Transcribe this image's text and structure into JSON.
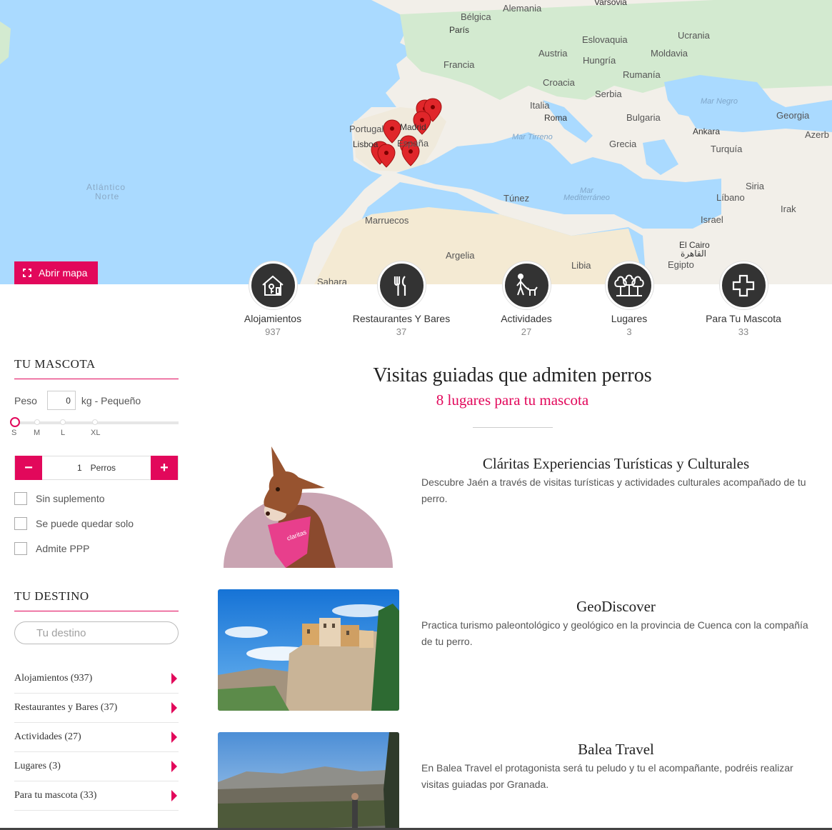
{
  "map": {
    "open_button_label": "Abrir mapa",
    "labels": {
      "varsovia": "Varsovia",
      "belgica": "Bélgica",
      "alemania": "Alemania",
      "paris": "París",
      "eslovaquia": "Eslovaquia",
      "ucrania": "Ucrania",
      "austria": "Austria",
      "moldavia": "Moldavia",
      "francia": "Francia",
      "hungria": "Hungría",
      "rumania": "Rumanía",
      "croacia": "Croacia",
      "serbia": "Serbia",
      "italia": "Italia",
      "roma": "Roma",
      "mar_negro": "Mar Negro",
      "georgia": "Georgia",
      "bulgaria": "Bulgaria",
      "portugal": "Portugal",
      "madrid": "Madrid",
      "lisboa": "Lisboa",
      "espana": "España",
      "mar_tirreno": "Mar Tirreno",
      "ankara": "Ankara",
      "azerb": "Azerb",
      "grecia": "Grecia",
      "turquia": "Turquía",
      "atlantico": "Atlántico",
      "norte": "Norte",
      "tunez": "Túnez",
      "mar": "Mar",
      "mediterraneo": "Mediterráneo",
      "siria": "Siria",
      "libano": "Líbano",
      "irak": "Irak",
      "marruecos": "Marruecos",
      "israel": "Israel",
      "argelia": "Argelia",
      "el_cairo": "El Cairo",
      "cairo_ar": "القاهرة",
      "libia": "Libia",
      "egipto": "Egipto",
      "sahara": "Sahara"
    }
  },
  "categories": [
    {
      "label": "Alojamientos",
      "count": "937"
    },
    {
      "label": "Restaurantes Y Bares",
      "count": "37"
    },
    {
      "label": "Actividades",
      "count": "27"
    },
    {
      "label": "Lugares",
      "count": "3"
    },
    {
      "label": "Para Tu Mascota",
      "count": "33"
    }
  ],
  "sidebar": {
    "pet_title": "TU MASCOTA",
    "weight_label": "Peso",
    "weight_value": "0",
    "weight_unit": "kg - Pequeño",
    "size_labels": [
      "S",
      "M",
      "L",
      "XL"
    ],
    "dog_count": "1",
    "dog_unit": "Perros",
    "minus": "−",
    "plus": "+",
    "checkboxes": [
      "Sin suplemento",
      "Se puede quedar solo",
      "Admite PPP"
    ],
    "dest_title": "TU DESTINO",
    "dest_placeholder": "Tu destino",
    "cat_links": [
      "Alojamientos (937)",
      "Restaurantes y Bares (37)",
      "Actividades (27)",
      "Lugares (3)",
      "Para tu mascota (33)"
    ]
  },
  "main": {
    "title": "Visitas guiadas que admiten perros",
    "subtitle": "8 lugares para tu mascota",
    "listings": [
      {
        "title": "Cláritas Experiencias Turísticas y Culturales",
        "desc": "Descubre Jaén a través de visitas turísticas y actividades culturales acompañado de tu perro.",
        "bandana_text": "claritas"
      },
      {
        "title": "GeoDiscover",
        "desc": "Practica turismo paleontológico y geológico en la provincia de Cuenca con la compañía de tu perro."
      },
      {
        "title": "Balea Travel",
        "desc": "En Balea Travel el protagonista será tu peludo y tu el acompañante, podréis realizar visitas guiadas por Granada."
      }
    ]
  },
  "colors": {
    "accent": "#e2085b",
    "water": "#aadaff",
    "land": "#f2efe9",
    "desert": "#f5ecd5",
    "green": "#cde9c6",
    "icon_bg": "#333333"
  }
}
